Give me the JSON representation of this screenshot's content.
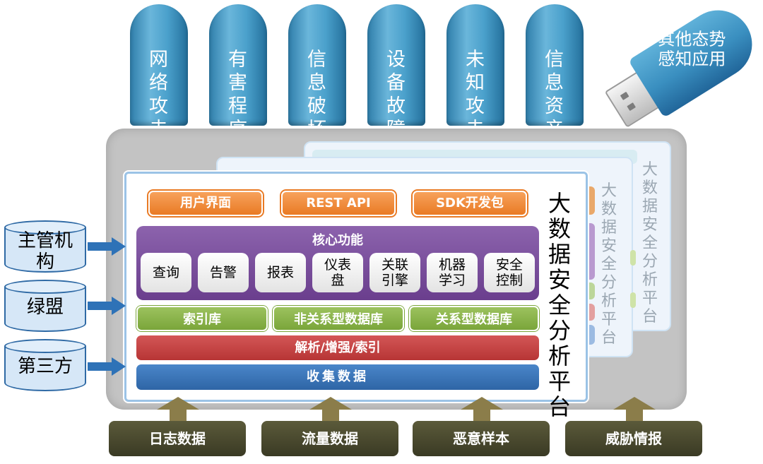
{
  "apps": [
    "网络攻击态势",
    "有害程序态势",
    "信息破坏监测",
    "设备故障追踪",
    "未知攻击态势",
    "信息资产态势"
  ],
  "usb_label": "其他态势感知应用",
  "platform": {
    "title": "大数据安全分析平台",
    "ghost_title_1": "大数据安全分析平台",
    "ghost_title_2": "大数据安全分析平台"
  },
  "interfaces": [
    "用户界面",
    "REST API",
    "SDK开发包"
  ],
  "core": {
    "title": "核心功能",
    "functions": [
      "查询",
      "告警",
      "报表",
      "仪表盘",
      "关联引擎",
      "机器学习",
      "安全控制"
    ]
  },
  "stores": [
    "索引库",
    "非关系型数据库",
    "关系型数据库"
  ],
  "parse_bar": "解析/增强/索引",
  "collect_bar": "收集数据",
  "left_sources": [
    "主管机构",
    "绿盟",
    "第三方"
  ],
  "bottom_sources": [
    "日志数据",
    "流量数据",
    "恶意样本",
    "威胁情报"
  ],
  "colors": {
    "pillar": "#4aa0cb",
    "orange": "#e97a24",
    "purple": "#6a3e8d",
    "green": "#7aa53a",
    "red": "#b73535",
    "blue": "#2e65a6",
    "source": "#3a3a24"
  }
}
